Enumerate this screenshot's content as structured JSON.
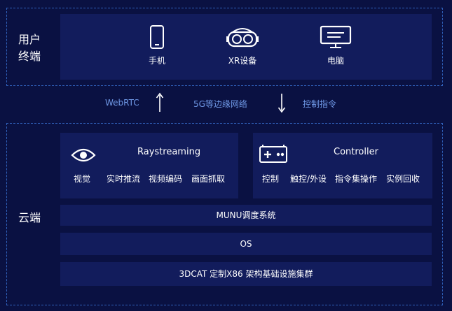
{
  "top": {
    "label_line1": "用户",
    "label_line2": "终端",
    "devices": [
      {
        "icon": "phone-icon",
        "label": "手机"
      },
      {
        "icon": "vr-headset-icon",
        "label": "XR设备"
      },
      {
        "icon": "monitor-icon",
        "label": "电脑"
      }
    ]
  },
  "middle": {
    "left": "WebRTC",
    "center": "5G等边缘网络",
    "right": "控制指令"
  },
  "cloud": {
    "label": "云端",
    "raystreaming": {
      "title": "Raystreaming",
      "icon": "eye-icon",
      "icon_label": "视觉",
      "items": [
        "实时推流",
        "视频编码",
        "画面抓取"
      ]
    },
    "controller": {
      "title": "Controller",
      "icon": "gamepad-icon",
      "icon_label": "控制",
      "items": [
        "触控/外设",
        "指令集操作",
        "实例回收"
      ]
    },
    "layers": [
      "MUNU调度系统",
      "OS",
      "3DCAT 定制X86 架构基础设施集群"
    ]
  }
}
